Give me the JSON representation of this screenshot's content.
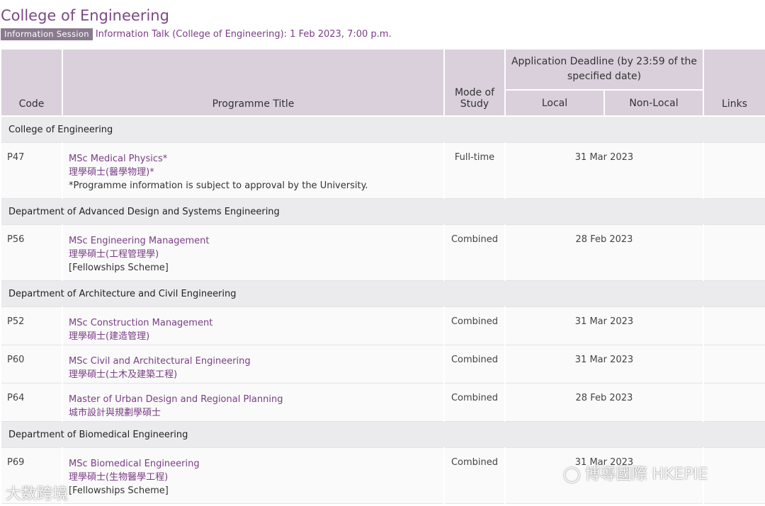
{
  "page": {
    "title": "College of Engineering",
    "badge": "Information Session",
    "talk": "Information Talk (College of Engineering): 1 Feb 2023, 7:00 p.m."
  },
  "headers": {
    "code": "Code",
    "title": "Programme Title",
    "mode": "Mode of Study",
    "deadline": "Application Deadline (by 23:59 of the specified date)",
    "local": "Local",
    "nonlocal": "Non-Local",
    "links": "Links"
  },
  "sections": [
    {
      "dept": "College of Engineering",
      "rows": [
        {
          "code": "P47",
          "en": "MSc Medical Physics*",
          "zh": "理學碩士(醫學物理)*",
          "note": "*Programme information is subject to approval by the University.",
          "mode": "Full-time",
          "deadline": "31 Mar 2023"
        }
      ]
    },
    {
      "dept": "Department of Advanced Design and Systems Engineering",
      "rows": [
        {
          "code": "P56",
          "en": "MSc Engineering Management",
          "zh": "理學碩士(工程管理學)",
          "note": "[Fellowships Scheme]",
          "mode": "Combined",
          "deadline": "28 Feb 2023"
        }
      ]
    },
    {
      "dept": "Department of Architecture and Civil Engineering",
      "rows": [
        {
          "code": "P52",
          "en": "MSc Construction Management",
          "zh": "理學碩士(建造管理)",
          "note": "",
          "mode": "Combined",
          "deadline": "31 Mar 2023"
        },
        {
          "code": "P60",
          "en": "MSc Civil and Architectural Engineering",
          "zh": "理學碩士(土木及建築工程)",
          "note": "",
          "mode": "Combined",
          "deadline": "31 Mar 2023"
        },
        {
          "code": "P64",
          "en": "Master of Urban Design and Regional Planning",
          "zh": "城市設計與規劃學碩士",
          "note": "",
          "mode": "Combined",
          "deadline": "28 Feb 2023"
        }
      ]
    },
    {
      "dept": "Department of Biomedical Engineering",
      "rows": [
        {
          "code": "P69",
          "en": "MSc Biomedical Engineering",
          "zh": "理學碩士(生物醫學工程)",
          "note": "[Fellowships Scheme]",
          "mode": "Combined",
          "deadline": "31 Mar 2023"
        }
      ]
    }
  ],
  "watermarks": {
    "left": "大数跨境",
    "right": "博導國際 HKEPIE"
  }
}
